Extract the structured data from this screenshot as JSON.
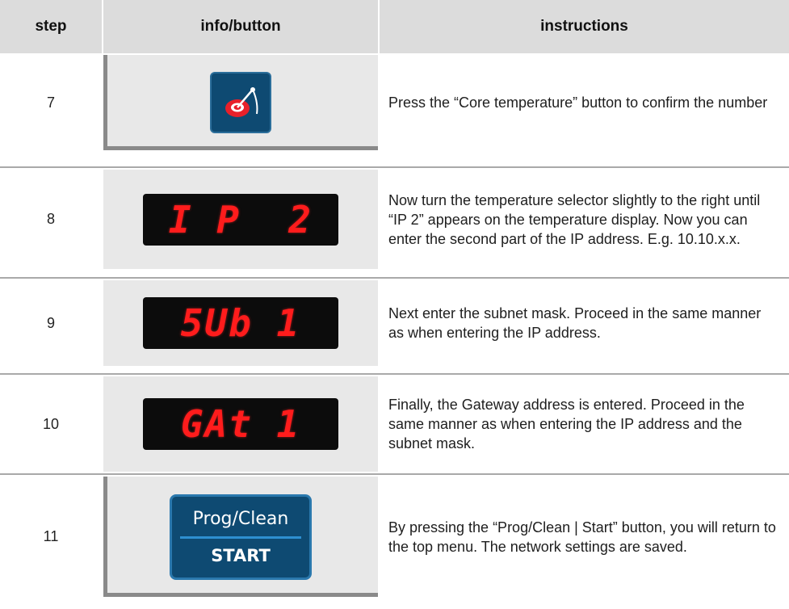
{
  "header": {
    "step": "step",
    "info": "info/button",
    "instructions": "instructions"
  },
  "rows": [
    {
      "step": "7",
      "icon": "core-temperature-icon",
      "instructions": "Press the “Core temperature” button to confirm the number"
    },
    {
      "step": "8",
      "display": "I P  2",
      "instructions": "Now turn the temperature selector slightly to the right until “IP 2” appears on the temperature display. Now you can enter the second part of the IP address. E.g. 10.10.x.x."
    },
    {
      "step": "9",
      "display": "5Ub 1",
      "instructions": "Next enter the subnet mask. Proceed in the same manner as when entering the IP address."
    },
    {
      "step": "10",
      "display": "GAt 1",
      "instructions": "Finally, the Gateway address is entered. Proceed in the same manner as when entering the IP address and the subnet mask."
    },
    {
      "step": "11",
      "button_top": "Prog/Clean",
      "button_bottom": "START",
      "instructions": "By pressing the “Prog/Clean | Start” button, you will return to the top menu. The network settings are saved."
    }
  ],
  "colors": {
    "header_bg": "#dcdcdc",
    "cell_bg": "#e8e8e8",
    "led_red": "#ff1c1c",
    "button_blue": "#0e4a72"
  }
}
